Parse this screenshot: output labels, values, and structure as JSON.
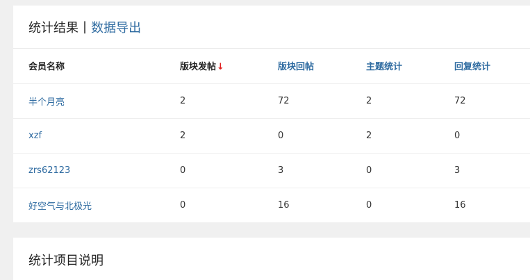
{
  "stats_panel": {
    "title": "统计结果",
    "separator": "|",
    "export_link": "数据导出"
  },
  "table": {
    "headers": {
      "member_name": "会员名称",
      "section_posts": "版块发帖",
      "sort_arrow": "↓",
      "section_replies": "版块回帖",
      "topic_stats": "主题统计",
      "reply_stats": "回复统计"
    },
    "rows": [
      {
        "member": "半个月亮",
        "section_posts": "2",
        "section_replies": "72",
        "topic_stats": "2",
        "reply_stats": "72"
      },
      {
        "member": "xzf",
        "section_posts": "2",
        "section_replies": "0",
        "topic_stats": "2",
        "reply_stats": "0"
      },
      {
        "member": "zrs62123",
        "section_posts": "0",
        "section_replies": "3",
        "topic_stats": "0",
        "reply_stats": "3"
      },
      {
        "member": "好空气与北极光",
        "section_posts": "0",
        "section_replies": "16",
        "topic_stats": "0",
        "reply_stats": "16"
      }
    ]
  },
  "desc_panel": {
    "title": "统计项目说明"
  },
  "colors": {
    "link": "#2d6aa0",
    "sort_arrow": "#e02020",
    "background": "#f0f0f0"
  }
}
